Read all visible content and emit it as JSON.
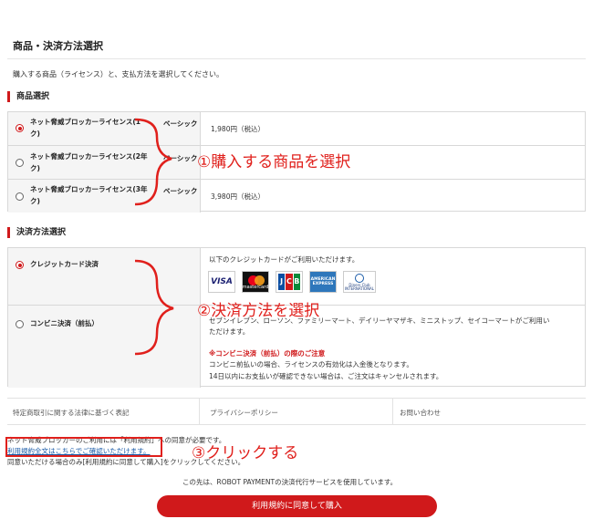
{
  "page": {
    "title": "商品・決済方法選択",
    "intro": "購入する商品（ライセンス）と、支払方法を選択してください。"
  },
  "products": {
    "section_title": "商品選択",
    "items": [
      {
        "name": "ネット脅威ブロッカーライセンス(1",
        "variant": "ベーシック",
        "name_tail": "ク)",
        "price": "1,980円（税込）",
        "selected": true
      },
      {
        "name": "ネット脅威ブロッカーライセンス(2年",
        "variant": "ベーシック",
        "name_tail": "ク)",
        "price": "",
        "selected": false
      },
      {
        "name": "ネット脅威ブロッカーライセンス(3年",
        "variant": "ベーシック",
        "name_tail": "ク)",
        "price": "3,980円（税込）",
        "selected": false
      }
    ],
    "annotation": "①購入する商品を選択"
  },
  "payment": {
    "section_title": "決済方法選択",
    "credit": {
      "label": "クレジットカード決済",
      "selected": true,
      "desc": "以下のクレジットカードがご利用いただけます。",
      "cards": [
        "VISA",
        "mastercard",
        "JCB",
        "AMERICAN EXPRESS",
        "Diners Club INTERNATIONAL"
      ]
    },
    "konbini": {
      "label": "コンビニ決済（前払）",
      "selected": false,
      "stores_line1": "セブンイレブン、ローソン、ファミリーマート、デイリーヤマザキ、ミニストップ、セイコーマートがご利用い",
      "stores_line2": "ただけます。",
      "notice_title": "※コンビニ決済（前払）の際のご注意",
      "notice_line1": "コンビニ前払いの場合、ライセンスの有効化は入金後となります。",
      "notice_line2": "14日以内にお支払いが確認できない場合は、ご注文はキャンセルされます。"
    },
    "annotation": "②決済方法を選択"
  },
  "footer_links": [
    "特定商取引に関する法律に基づく表記",
    "プライバシーポリシー",
    "お問い合わせ"
  ],
  "terms": {
    "line1": "ネット脅威ブロッカーのご利用には「利用規約」への同意が必要です。",
    "link": "利用規約全文はこちらでご確認いただけます。",
    "line3": "同意いただける場合のみ[利用規約に同意して購入]をクリックしてください。",
    "annotation": "③クリックする"
  },
  "robot_notice": "この先は、ROBOT PAYMENTの決済代行サービスを使用しています。",
  "cta_label": "利用規約に同意して購入",
  "colors": {
    "accent": "#d0191b",
    "annotation": "#e0201c"
  }
}
